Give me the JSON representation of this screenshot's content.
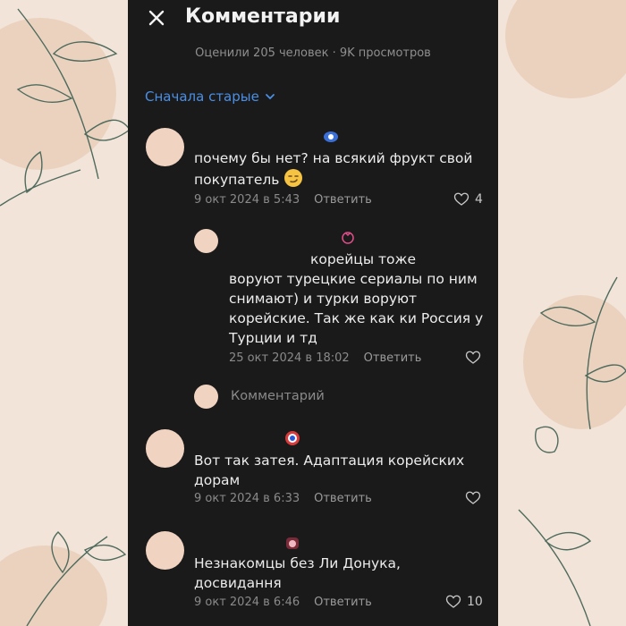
{
  "header": {
    "title": "Комментарии"
  },
  "stats": {
    "text": "Оценили 205 человек · 9K просмотров"
  },
  "sort": {
    "label": "Сначала старые"
  },
  "colors": {
    "accent": "#4a8fe6",
    "background": "#1a1a1a",
    "avatar": "#f0d3c0"
  },
  "comments": [
    {
      "text": "почему бы нет? на всякий фрукт свой покупатель",
      "emoji": "smirk-face",
      "date": "9 окт 2024 в 5:43",
      "reply_label": "Ответить",
      "likes": "4",
      "reply": {
        "text_first": "корейцы тоже",
        "text_rest": "воруют турецкие сериалы по ним снимают) и турки воруют корейские. Так же как ки Россия у Турции и тд",
        "date": "25 окт 2024 в 18:02",
        "reply_label": "Ответить",
        "likes": ""
      },
      "reply_input_placeholder": "Комментарий"
    },
    {
      "text": "Вот так затея. Адаптация корейских дорам",
      "date": "9 окт 2024 в 6:33",
      "reply_label": "Ответить",
      "likes": ""
    },
    {
      "text": "Незнакомцы без Ли Донука, досвидання",
      "date": "9 окт 2024 в 6:46",
      "reply_label": "Ответить",
      "likes": "10"
    }
  ]
}
